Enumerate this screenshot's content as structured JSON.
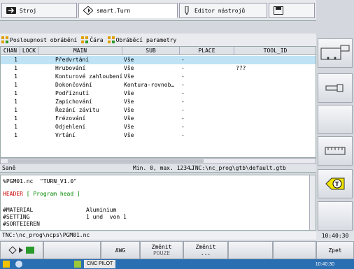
{
  "tabs": [
    {
      "label": "Stroj"
    },
    {
      "label": "smart.Turn"
    },
    {
      "label": "Editor nástrojů"
    },
    {
      "label": ""
    }
  ],
  "toolbar": {
    "seq": "Posloupnost obrábění",
    "line": "Čára",
    "params": "Obráběcí parametry"
  },
  "table": {
    "columns": [
      "CHAN",
      "LOCK",
      "MAIN",
      "SUB",
      "PLACE",
      "TOOL_ID"
    ],
    "rows": [
      {
        "chan": "1",
        "lock": "",
        "main": "Předvrtání",
        "sub": "Vše",
        "place": "-",
        "tool": ""
      },
      {
        "chan": "1",
        "lock": "",
        "main": "Hrubování",
        "sub": "Vše",
        "place": "-",
        "tool": "???"
      },
      {
        "chan": "1",
        "lock": "",
        "main": "Konturové zahloubení",
        "sub": "Vše",
        "place": "-",
        "tool": ""
      },
      {
        "chan": "1",
        "lock": "",
        "main": "Dokončování",
        "sub": "Kontura-rovnob…",
        "place": "-",
        "tool": ""
      },
      {
        "chan": "1",
        "lock": "",
        "main": "Podříznutí",
        "sub": "Vše",
        "place": "-",
        "tool": ""
      },
      {
        "chan": "1",
        "lock": "",
        "main": "Zapichování",
        "sub": "Vše",
        "place": "-",
        "tool": ""
      },
      {
        "chan": "1",
        "lock": "",
        "main": "Řezání závitu",
        "sub": "Vše",
        "place": "-",
        "tool": ""
      },
      {
        "chan": "1",
        "lock": "",
        "main": "Frézování",
        "sub": "Vše",
        "place": "-",
        "tool": ""
      },
      {
        "chan": "1",
        "lock": "",
        "main": "Odjehlení",
        "sub": "Vše",
        "place": "-",
        "tool": ""
      },
      {
        "chan": "1",
        "lock": "",
        "main": "Vrtání",
        "sub": "Vše",
        "place": "-",
        "tool": ""
      }
    ]
  },
  "status": {
    "left": "Saně",
    "mid": "Min. 0, max. 1234…",
    "path": "TNC:\\nc_prog\\gtb\\default.gtb"
  },
  "editor": {
    "l1": "%PGM01.nc  \"TURN_V1.0\"",
    "l2a": "HEADER",
    "l2b": "[ Program head ]",
    "l3a": "#MATERIAL",
    "l3b": "Aluminium",
    "l4a": "#SETTING",
    "l4b": "1 und  von 1",
    "l5": "#SORTEIEREN"
  },
  "pathbar": "TNC:\\nc_prog\\ncps\\PGM01.nc",
  "clock": "10:40:30",
  "softkeys": {
    "awg": "AWG",
    "zmenit1a": "Změnit",
    "zmenit1b": "POUZE",
    "zmenit2a": "Změnit",
    "zmenit2b": "...",
    "zpet": "Zpet"
  },
  "taskbar": {
    "app": "CNC PILOT",
    "time": "10:40:30"
  },
  "colors": {
    "selection": "#bfe3f5",
    "header_red": "#cc0000",
    "comment_green": "#008800"
  }
}
